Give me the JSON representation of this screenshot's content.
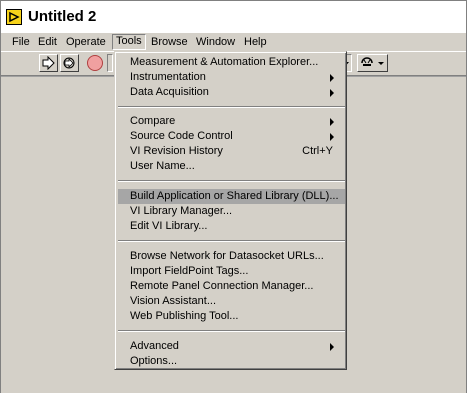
{
  "window": {
    "title": "Untitled 2"
  },
  "menubar": {
    "items": [
      {
        "label": "File"
      },
      {
        "label": "Edit"
      },
      {
        "label": "Operate"
      },
      {
        "label": "Tools"
      },
      {
        "label": "Browse"
      },
      {
        "label": "Window"
      },
      {
        "label": "Help"
      }
    ],
    "active": "Tools"
  },
  "toolbar": {
    "run_icon": "run-arrow-icon",
    "run_continuous_icon": "run-continuously-icon",
    "abort_icon": "abort-stop-icon",
    "font_dropdown_icon": "chevron-down-icon",
    "align_dropdown_icon": "align-objects-icon"
  },
  "tools_menu": {
    "items": [
      {
        "label": "Measurement & Automation Explorer...",
        "submenu": false
      },
      {
        "label": "Instrumentation",
        "submenu": true
      },
      {
        "label": "Data Acquisition",
        "submenu": true
      },
      {
        "label": "Compare",
        "submenu": true
      },
      {
        "label": "Source Code Control",
        "submenu": true
      },
      {
        "label": "VI Revision History",
        "shortcut": "Ctrl+Y"
      },
      {
        "label": "User Name..."
      },
      {
        "label": "Build Application or Shared Library (DLL)...",
        "highlighted": true
      },
      {
        "label": "VI Library Manager..."
      },
      {
        "label": "Edit VI Library..."
      },
      {
        "label": "Browse Network for Datasocket URLs..."
      },
      {
        "label": "Import FieldPoint Tags..."
      },
      {
        "label": "Remote Panel Connection Manager..."
      },
      {
        "label": "Vision Assistant..."
      },
      {
        "label": "Web Publishing Tool..."
      },
      {
        "label": "Advanced",
        "submenu": true
      },
      {
        "label": "Options..."
      }
    ]
  }
}
